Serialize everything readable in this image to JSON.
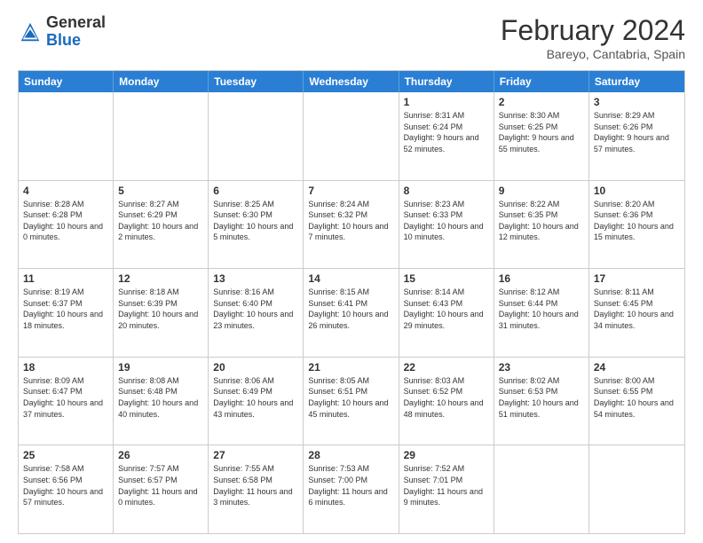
{
  "logo": {
    "general": "General",
    "blue": "Blue"
  },
  "title": "February 2024",
  "location": "Bareyo, Cantabria, Spain",
  "weekdays": [
    "Sunday",
    "Monday",
    "Tuesday",
    "Wednesday",
    "Thursday",
    "Friday",
    "Saturday"
  ],
  "rows": [
    [
      {
        "day": "",
        "info": ""
      },
      {
        "day": "",
        "info": ""
      },
      {
        "day": "",
        "info": ""
      },
      {
        "day": "",
        "info": ""
      },
      {
        "day": "1",
        "info": "Sunrise: 8:31 AM\nSunset: 6:24 PM\nDaylight: 9 hours and 52 minutes."
      },
      {
        "day": "2",
        "info": "Sunrise: 8:30 AM\nSunset: 6:25 PM\nDaylight: 9 hours and 55 minutes."
      },
      {
        "day": "3",
        "info": "Sunrise: 8:29 AM\nSunset: 6:26 PM\nDaylight: 9 hours and 57 minutes."
      }
    ],
    [
      {
        "day": "4",
        "info": "Sunrise: 8:28 AM\nSunset: 6:28 PM\nDaylight: 10 hours and 0 minutes."
      },
      {
        "day": "5",
        "info": "Sunrise: 8:27 AM\nSunset: 6:29 PM\nDaylight: 10 hours and 2 minutes."
      },
      {
        "day": "6",
        "info": "Sunrise: 8:25 AM\nSunset: 6:30 PM\nDaylight: 10 hours and 5 minutes."
      },
      {
        "day": "7",
        "info": "Sunrise: 8:24 AM\nSunset: 6:32 PM\nDaylight: 10 hours and 7 minutes."
      },
      {
        "day": "8",
        "info": "Sunrise: 8:23 AM\nSunset: 6:33 PM\nDaylight: 10 hours and 10 minutes."
      },
      {
        "day": "9",
        "info": "Sunrise: 8:22 AM\nSunset: 6:35 PM\nDaylight: 10 hours and 12 minutes."
      },
      {
        "day": "10",
        "info": "Sunrise: 8:20 AM\nSunset: 6:36 PM\nDaylight: 10 hours and 15 minutes."
      }
    ],
    [
      {
        "day": "11",
        "info": "Sunrise: 8:19 AM\nSunset: 6:37 PM\nDaylight: 10 hours and 18 minutes."
      },
      {
        "day": "12",
        "info": "Sunrise: 8:18 AM\nSunset: 6:39 PM\nDaylight: 10 hours and 20 minutes."
      },
      {
        "day": "13",
        "info": "Sunrise: 8:16 AM\nSunset: 6:40 PM\nDaylight: 10 hours and 23 minutes."
      },
      {
        "day": "14",
        "info": "Sunrise: 8:15 AM\nSunset: 6:41 PM\nDaylight: 10 hours and 26 minutes."
      },
      {
        "day": "15",
        "info": "Sunrise: 8:14 AM\nSunset: 6:43 PM\nDaylight: 10 hours and 29 minutes."
      },
      {
        "day": "16",
        "info": "Sunrise: 8:12 AM\nSunset: 6:44 PM\nDaylight: 10 hours and 31 minutes."
      },
      {
        "day": "17",
        "info": "Sunrise: 8:11 AM\nSunset: 6:45 PM\nDaylight: 10 hours and 34 minutes."
      }
    ],
    [
      {
        "day": "18",
        "info": "Sunrise: 8:09 AM\nSunset: 6:47 PM\nDaylight: 10 hours and 37 minutes."
      },
      {
        "day": "19",
        "info": "Sunrise: 8:08 AM\nSunset: 6:48 PM\nDaylight: 10 hours and 40 minutes."
      },
      {
        "day": "20",
        "info": "Sunrise: 8:06 AM\nSunset: 6:49 PM\nDaylight: 10 hours and 43 minutes."
      },
      {
        "day": "21",
        "info": "Sunrise: 8:05 AM\nSunset: 6:51 PM\nDaylight: 10 hours and 45 minutes."
      },
      {
        "day": "22",
        "info": "Sunrise: 8:03 AM\nSunset: 6:52 PM\nDaylight: 10 hours and 48 minutes."
      },
      {
        "day": "23",
        "info": "Sunrise: 8:02 AM\nSunset: 6:53 PM\nDaylight: 10 hours and 51 minutes."
      },
      {
        "day": "24",
        "info": "Sunrise: 8:00 AM\nSunset: 6:55 PM\nDaylight: 10 hours and 54 minutes."
      }
    ],
    [
      {
        "day": "25",
        "info": "Sunrise: 7:58 AM\nSunset: 6:56 PM\nDaylight: 10 hours and 57 minutes."
      },
      {
        "day": "26",
        "info": "Sunrise: 7:57 AM\nSunset: 6:57 PM\nDaylight: 11 hours and 0 minutes."
      },
      {
        "day": "27",
        "info": "Sunrise: 7:55 AM\nSunset: 6:58 PM\nDaylight: 11 hours and 3 minutes."
      },
      {
        "day": "28",
        "info": "Sunrise: 7:53 AM\nSunset: 7:00 PM\nDaylight: 11 hours and 6 minutes."
      },
      {
        "day": "29",
        "info": "Sunrise: 7:52 AM\nSunset: 7:01 PM\nDaylight: 11 hours and 9 minutes."
      },
      {
        "day": "",
        "info": ""
      },
      {
        "day": "",
        "info": ""
      }
    ]
  ]
}
